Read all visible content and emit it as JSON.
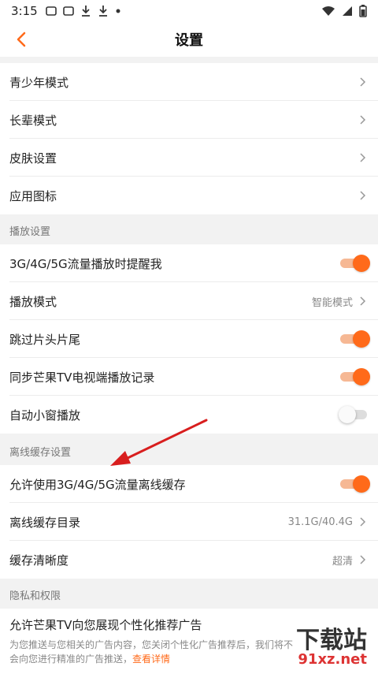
{
  "status": {
    "time": "3:15"
  },
  "header": {
    "title": "设置"
  },
  "general": [
    {
      "label": "青少年模式"
    },
    {
      "label": "长辈模式"
    },
    {
      "label": "皮肤设置"
    },
    {
      "label": "应用图标"
    }
  ],
  "playback": {
    "heading": "播放设置",
    "rows": [
      {
        "label": "3G/4G/5G流量播放时提醒我",
        "toggle": true
      },
      {
        "label": "播放模式",
        "value": "智能模式"
      },
      {
        "label": "跳过片头片尾",
        "toggle": true
      },
      {
        "label": "同步芒果TV电视端播放记录",
        "toggle": true
      },
      {
        "label": "自动小窗播放",
        "toggle": false
      }
    ]
  },
  "offline": {
    "heading": "离线缓存设置",
    "rows": [
      {
        "label": "允许使用3G/4G/5G流量离线缓存",
        "toggle": true
      },
      {
        "label": "离线缓存目录",
        "value": "31.1G/40.4G"
      },
      {
        "label": "缓存清晰度",
        "value": "超清"
      }
    ]
  },
  "privacy": {
    "heading": "隐私和权限",
    "ad_label": "允许芒果TV向您展现个性化推荐广告",
    "ad_desc": "为您推送与您相关的广告内容，您关闭个性化广告推荐后，我们将不会向您进行精准的广告推送，",
    "ad_link": "查看详情"
  },
  "watermark": {
    "text": "下载站",
    "url": "91xz.net"
  },
  "colors": {
    "accent": "#ff6a1a",
    "arrow": "#d81e1e"
  }
}
